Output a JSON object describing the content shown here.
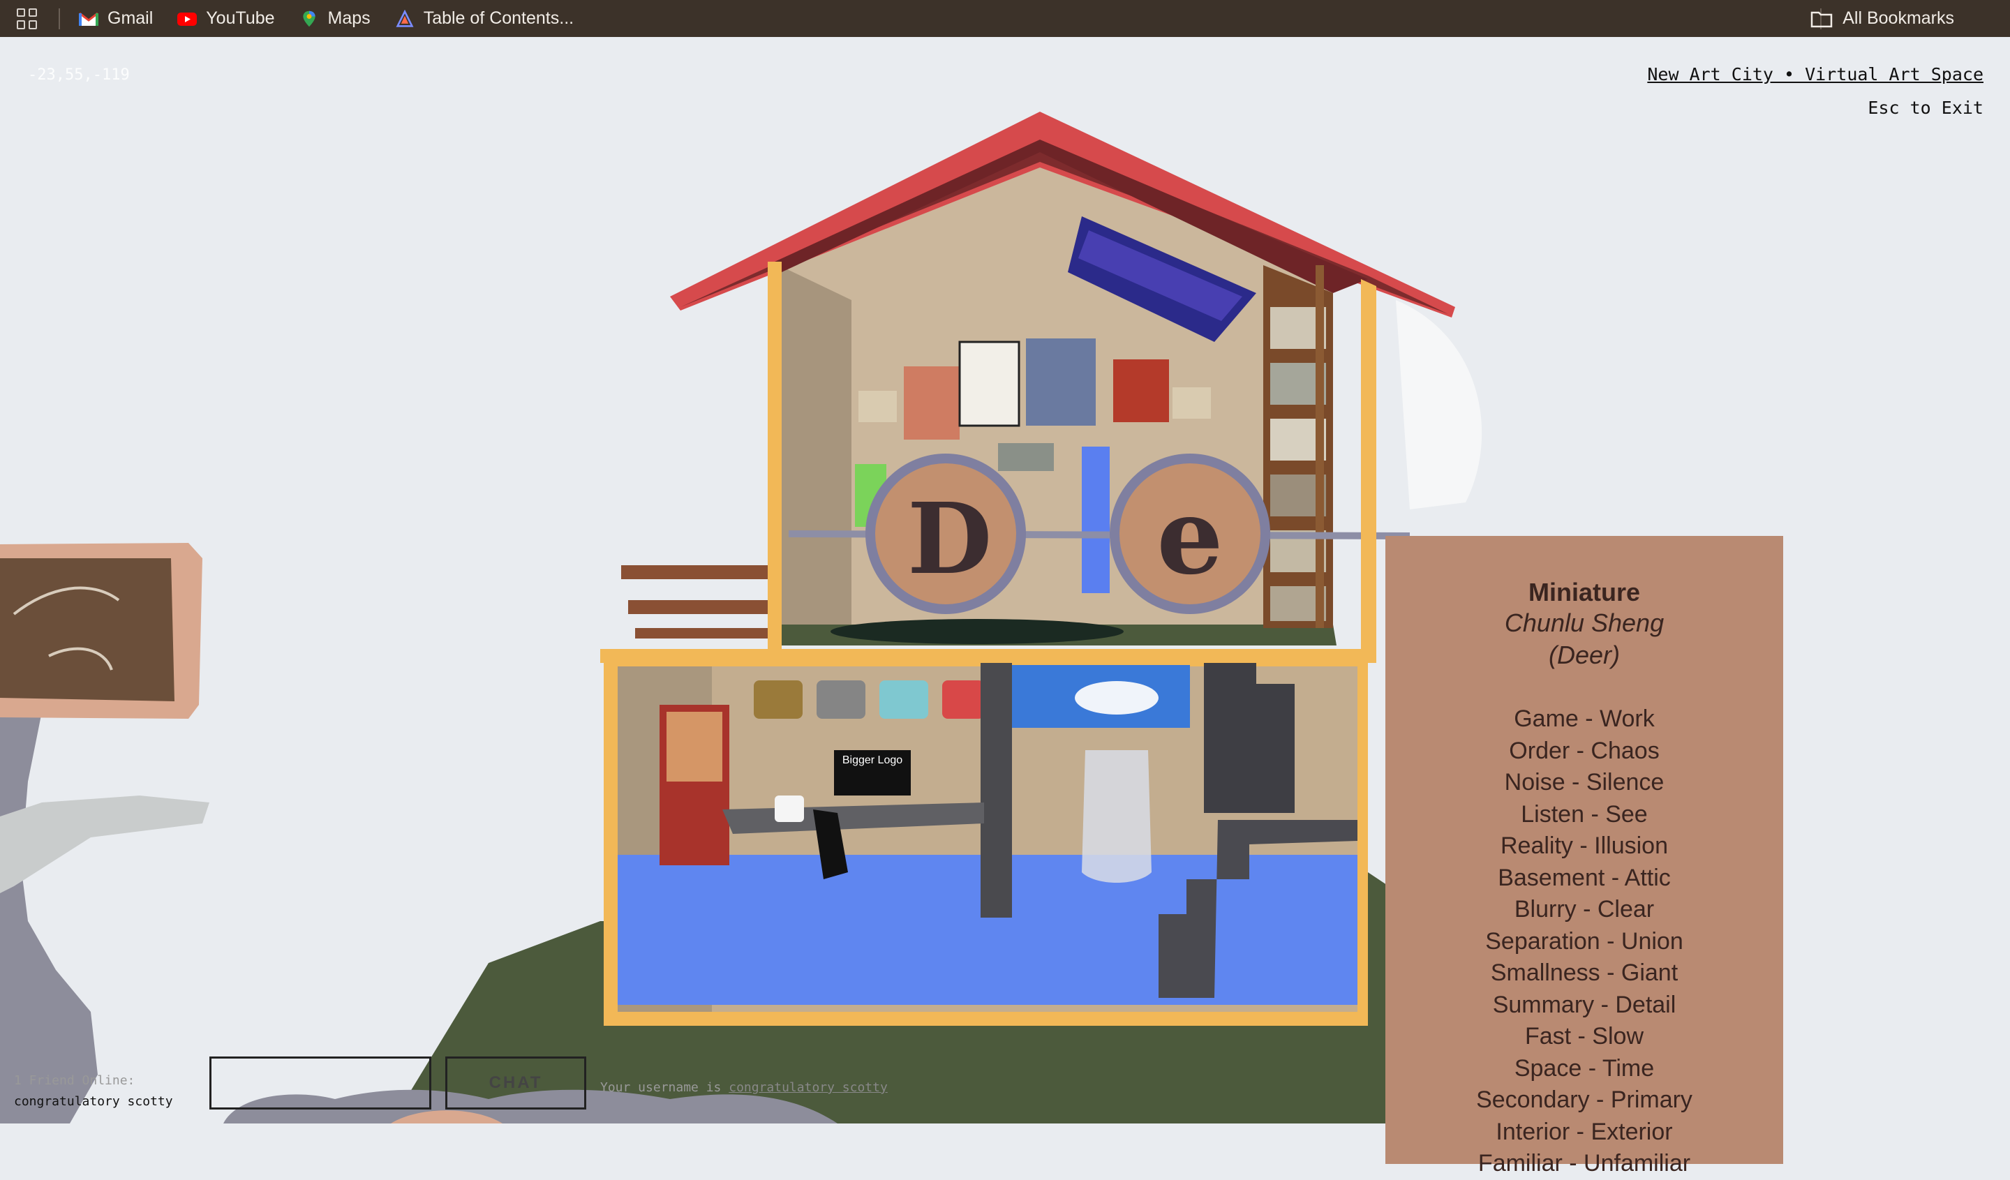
{
  "bookmarks_bar": {
    "items": [
      {
        "label": "Gmail",
        "icon": "gmail-icon"
      },
      {
        "label": "YouTube",
        "icon": "youtube-icon"
      },
      {
        "label": "Maps",
        "icon": "maps-icon"
      },
      {
        "label": "Table of Contents...",
        "icon": "doc-icon"
      }
    ],
    "all_bookmarks": "All Bookmarks"
  },
  "hud": {
    "coordinates": "-23,55,-119",
    "site_link": "New Art City • Virtual Art Space",
    "exit_hint": "Esc to Exit",
    "friends_online": "1 Friend Online:",
    "friend_name": "congratulatory scotty",
    "chat_button": "CHAT",
    "username_prefix": "Your username is",
    "username": "congratulatory scotty"
  },
  "scene": {
    "glasses_letters": [
      "D",
      "e"
    ],
    "monitor_text": "Bigger Logo",
    "colors": {
      "roof": "#c4474b",
      "walls": "#e8b75c",
      "floor": "#5f86f0",
      "ground": "#4c5a3c",
      "label": "#b98a72"
    }
  },
  "artwork_label": {
    "title": "Miniature",
    "artist": "Chunlu Sheng",
    "artist_alias": "(Deer)",
    "pairs": [
      "Game - Work",
      "Order - Chaos",
      "Noise - Silence",
      "Listen - See",
      "Reality - Illusion",
      "Basement - Attic",
      "Blurry - Clear",
      "Separation - Union",
      "Smallness - Giant",
      "Summary - Detail",
      "Fast - Slow",
      "Space - Time",
      "Secondary - Primary",
      "Interior - Exterior",
      "Familiar - Unfamiliar"
    ]
  }
}
